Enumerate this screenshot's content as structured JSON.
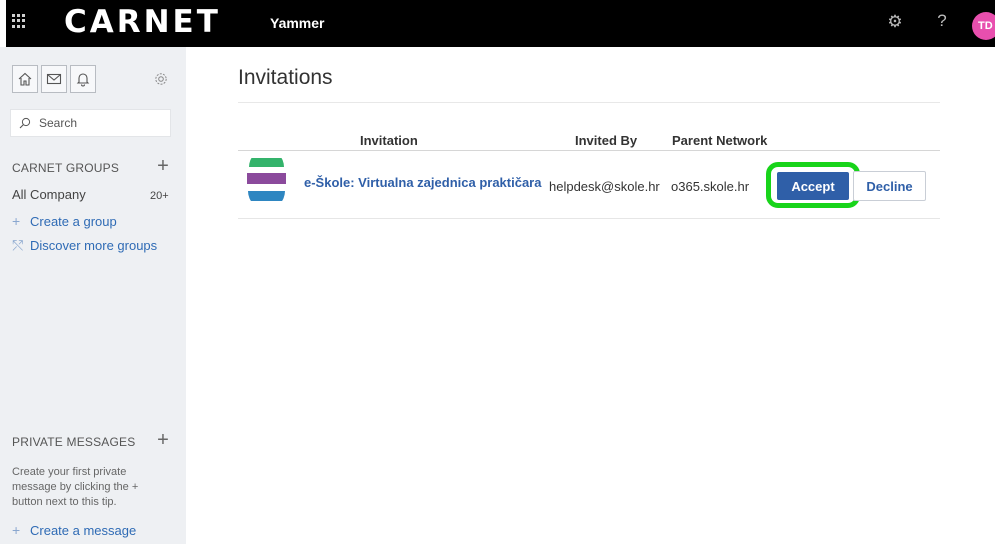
{
  "topbar": {
    "brand": "CARNET",
    "app_name": "Yammer",
    "avatar_initials": "TD",
    "icons": [
      "app-launcher-icon",
      "gear-icon",
      "help-icon"
    ]
  },
  "sidebar": {
    "search_placeholder": "Search",
    "nav_icons": [
      "home-icon",
      "inbox-icon",
      "notifications-icon",
      "gear-icon"
    ],
    "groups_heading": "CARNET GROUPS",
    "groups": [
      {
        "label": "All Company",
        "count": "20+"
      }
    ],
    "create_group": "Create a group",
    "discover_groups": "Discover more groups",
    "private_heading": "PRIVATE MESSAGES",
    "private_tip": "Create your first private message by clicking the + button next to this tip.",
    "create_message": "Create a message"
  },
  "main": {
    "title": "Invitations",
    "columns": [
      "Invitation",
      "Invited By",
      "Parent Network"
    ],
    "invitations": [
      {
        "group": "e-Škole: Virtualna zajednica praktičara",
        "invited_by": "helpdesk@skole.hr",
        "network": "o365.skole.hr",
        "accept_label": "Accept",
        "decline_label": "Decline"
      }
    ]
  },
  "colors": {
    "topbar": "#000000",
    "sidebar": "#eef0f3",
    "accent": "#2f5fa8",
    "highlight": "#18d41a",
    "avatar": "#e84fae",
    "logo_stripes": [
      "#34b36b",
      "#8b4a9c",
      "#2e86c1"
    ]
  }
}
